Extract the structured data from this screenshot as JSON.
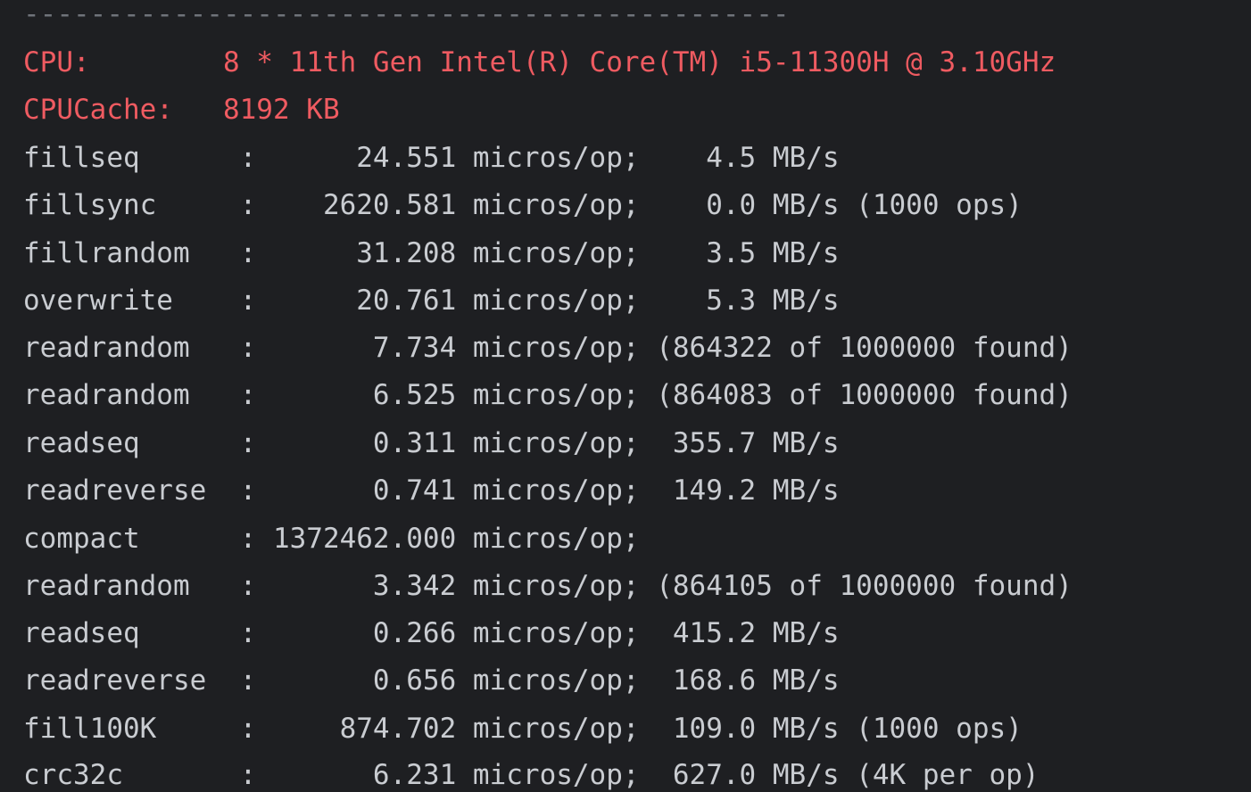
{
  "separator": "----------------------------------------------",
  "header": [
    {
      "text": "CPU:        8 * 11th Gen Intel(R) Core(TM) i5-11300H @ 3.10GHz"
    },
    {
      "text": "CPUCache:   8192 KB"
    }
  ],
  "results": [
    {
      "text": "fillseq      :      24.551 micros/op;    4.5 MB/s"
    },
    {
      "text": "fillsync     :    2620.581 micros/op;    0.0 MB/s (1000 ops)"
    },
    {
      "text": "fillrandom   :      31.208 micros/op;    3.5 MB/s"
    },
    {
      "text": "overwrite    :      20.761 micros/op;    5.3 MB/s"
    },
    {
      "text": "readrandom   :       7.734 micros/op; (864322 of 1000000 found)"
    },
    {
      "text": "readrandom   :       6.525 micros/op; (864083 of 1000000 found)"
    },
    {
      "text": "readseq      :       0.311 micros/op;  355.7 MB/s"
    },
    {
      "text": "readreverse  :       0.741 micros/op;  149.2 MB/s"
    },
    {
      "text": "compact      : 1372462.000 micros/op;"
    },
    {
      "text": "readrandom   :       3.342 micros/op; (864105 of 1000000 found)"
    },
    {
      "text": "readseq      :       0.266 micros/op;  415.2 MB/s"
    },
    {
      "text": "readreverse  :       0.656 micros/op;  168.6 MB/s"
    },
    {
      "text": "fill100K     :     874.702 micros/op;  109.0 MB/s (1000 ops)"
    },
    {
      "text": "crc32c       :       6.231 micros/op;  627.0 MB/s (4K per op)"
    }
  ],
  "colors": {
    "background": "#1e1f22",
    "text": "#c9ccd1",
    "header_red": "#ef5b61",
    "separator": "#6f737a"
  }
}
